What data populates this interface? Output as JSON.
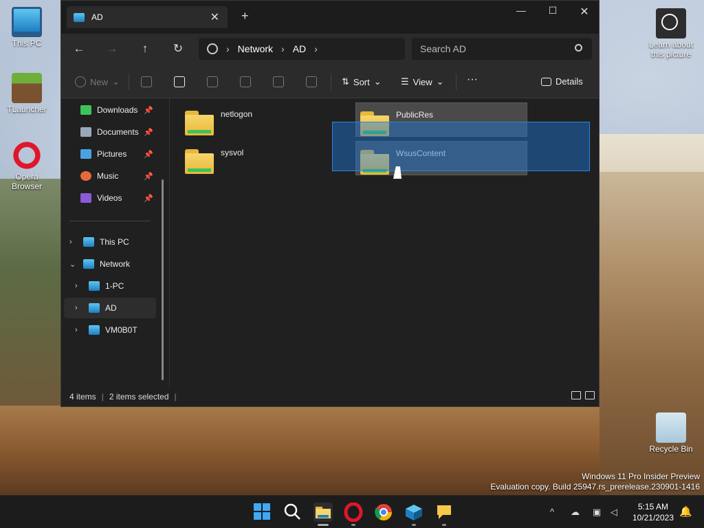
{
  "desktop": {
    "icons": [
      {
        "label": "This PC",
        "icon": "monitor-icon"
      },
      {
        "label": "TLauncher",
        "icon": "tlauncher-icon"
      },
      {
        "label": "Opera Browser",
        "icon": "opera-icon"
      },
      {
        "label": "Learn about this picture",
        "icon": "camera-icon"
      },
      {
        "label": "Recycle Bin",
        "icon": "recycle-bin-icon"
      }
    ],
    "watermark_line1": "Windows 11 Pro Insider Preview",
    "watermark_line2": "Evaluation copy. Build 25947.rs_prerelease.230901-1416"
  },
  "window": {
    "tab_title": "AD",
    "close_tab_glyph": "✕",
    "new_tab_glyph": "+",
    "minimize_glyph": "—",
    "maximize_glyph": "☐",
    "close_glyph": "✕"
  },
  "nav": {
    "back_glyph": "←",
    "forward_glyph": "→",
    "up_glyph": "↑",
    "refresh_glyph": "↻",
    "breadcrumb": [
      "Network",
      "AD"
    ],
    "breadcrumb_sep": "›",
    "search_placeholder": "Search AD"
  },
  "toolbar": {
    "new_label": "New",
    "sort_label": "Sort",
    "view_label": "View",
    "more_label": "···",
    "details_label": "Details"
  },
  "sidebar": {
    "quick": [
      {
        "label": "Downloads",
        "icon": "download-icon",
        "color": "#3fc25a"
      },
      {
        "label": "Documents",
        "icon": "document-icon",
        "color": "#9aa7b8"
      },
      {
        "label": "Pictures",
        "icon": "picture-icon",
        "color": "#4aa3e0"
      },
      {
        "label": "Music",
        "icon": "music-icon",
        "color": "#e56a3a"
      },
      {
        "label": "Videos",
        "icon": "video-icon",
        "color": "#8a5ad8"
      }
    ],
    "pin_glyph": "📌",
    "tree": [
      {
        "label": "This PC",
        "expanded": false
      },
      {
        "label": "Network",
        "expanded": true
      },
      {
        "label": "1-PC",
        "expanded": false
      },
      {
        "label": "AD",
        "expanded": false,
        "selected": true
      },
      {
        "label": "VM0B0T",
        "expanded": false
      }
    ],
    "collapsed_glyph": "›",
    "expanded_glyph": "⌄"
  },
  "content": {
    "folders": [
      {
        "name": "netlogon",
        "selected": false
      },
      {
        "name": "PublicRes",
        "selected": true
      },
      {
        "name": "sysvol",
        "selected": false
      },
      {
        "name": "WsusContent",
        "selected": true
      }
    ]
  },
  "status": {
    "item_count": "4 items",
    "selected_count": "2 items selected"
  },
  "taskbar": {
    "time": "5:15 AM",
    "date": "10/21/2023",
    "tray_caret": "^"
  }
}
